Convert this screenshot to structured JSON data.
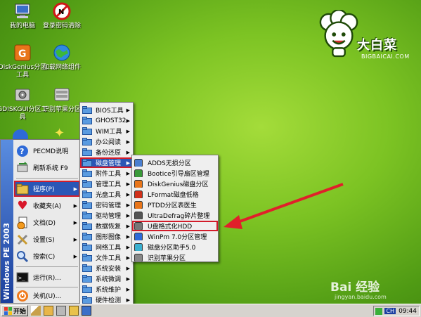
{
  "desktop": {
    "icons": [
      {
        "label": "我的电脑",
        "icon": "computer-icon"
      },
      {
        "label": "登录密码清除",
        "icon": "password-clear-icon"
      },
      {
        "label": "DiskGenius分区工具",
        "icon": "diskgenius-icon"
      },
      {
        "label": "加载网络组件",
        "icon": "network-globe-icon"
      },
      {
        "label": "GDISKGUI分区工具",
        "icon": "gdisk-icon"
      },
      {
        "label": "识别苹果分区",
        "icon": "apple-partition-icon"
      }
    ]
  },
  "logo": {
    "brand": "大白菜",
    "sub": "BIGBAICAI.COM"
  },
  "start_menu": {
    "banner": "Windows PE 2003",
    "items": [
      {
        "label": "PECMD说明"
      },
      {
        "label": "刷新系统 F9"
      },
      {
        "label": "程序(P)"
      },
      {
        "label": "收藏夹(A)"
      },
      {
        "label": "文档(D)"
      },
      {
        "label": "设置(S)"
      },
      {
        "label": "搜索(C)"
      },
      {
        "label": "运行(R)..."
      },
      {
        "label": "关机(U)..."
      }
    ]
  },
  "programs_menu": {
    "items": [
      "BIOS工具",
      "GHOST32",
      "WIM工具",
      "办公阅读",
      "备份还原",
      "磁盘管理",
      "附件工具",
      "管理工具",
      "光盘工具",
      "密码管理",
      "驱动管理",
      "数据恢复",
      "图形图像",
      "网络工具",
      "文件工具",
      "系统安装",
      "系统微调",
      "系统维护",
      "硬件检测",
      "临时文件"
    ],
    "selected": "磁盘管理"
  },
  "disk_menu": {
    "items": [
      "ADDS无损分区",
      "Bootice引导扇区管理",
      "DiskGenius磁盘分区",
      "LFormat磁盘低格",
      "PTDD分区表医生",
      "UltraDefrag碎片整理",
      "U盘格式化HDD",
      "WinPm 7.0分区管理",
      "磁盘分区助手5.0",
      "识别苹果分区"
    ],
    "highlighted": "U盘格式化HDD"
  },
  "taskbar": {
    "start_label": "开始",
    "lang": "CH",
    "clock": "09:44"
  },
  "watermark": {
    "text": "Bai 经验",
    "sub": "jingyan.baidu.com"
  },
  "colors": {
    "menu_selected": "#2a56b6",
    "highlight_border": "#d21c2a",
    "arrow": "#e0202a"
  }
}
